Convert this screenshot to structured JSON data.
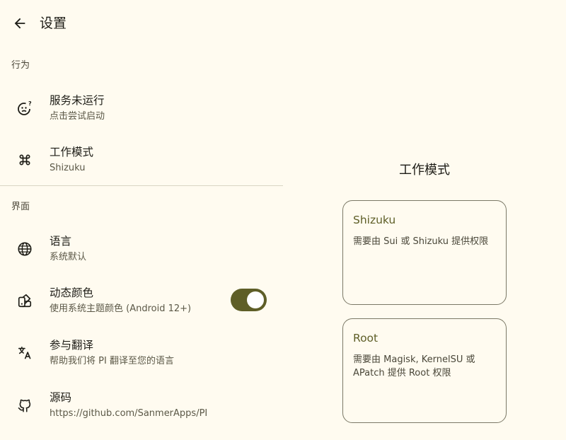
{
  "header": {
    "title": "设置"
  },
  "sections": {
    "behavior": "行为",
    "interface": "界面"
  },
  "items": {
    "service": {
      "title": "服务未运行",
      "subtitle": "点击尝试启动"
    },
    "work_mode": {
      "title": "工作模式",
      "subtitle": "Shizuku"
    },
    "language": {
      "title": "语言",
      "subtitle": "系统默认"
    },
    "dynamic_color": {
      "title": "动态颜色",
      "subtitle": "使用系统主题颜色 (Android 12+)",
      "enabled": true
    },
    "translate": {
      "title": "参与翻译",
      "subtitle": "帮助我们将 PI 翻译至您的语言"
    },
    "source": {
      "title": "源码",
      "subtitle": "https://github.com/SanmerApps/PI"
    }
  },
  "work_mode_panel": {
    "title": "工作模式",
    "options": [
      {
        "name": "Shizuku",
        "description": "需要由 Sui 或 Shizuku 提供权限"
      },
      {
        "name": "Root",
        "description": "需要由 Magisk, KernelSU 或 APatch 提供 Root 权限"
      }
    ]
  },
  "colors": {
    "background": "#fffbf0",
    "accent": "#5e5e27",
    "text": "#1d1c16"
  }
}
